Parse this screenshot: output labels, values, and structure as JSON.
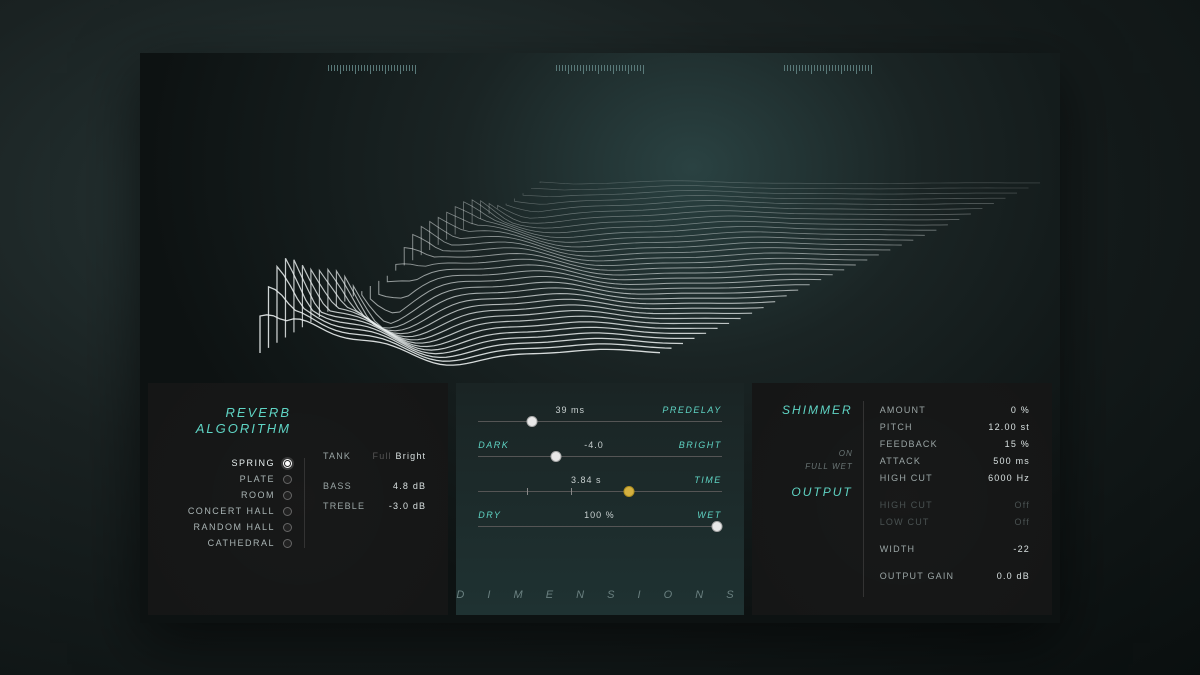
{
  "reverb_algorithm": {
    "title_line1": "REVERB",
    "title_line2": "ALGORITHM",
    "items": [
      {
        "label": "SPRING",
        "selected": true
      },
      {
        "label": "PLATE",
        "selected": false
      },
      {
        "label": "ROOM",
        "selected": false
      },
      {
        "label": "CONCERT HALL",
        "selected": false
      },
      {
        "label": "RANDOM HALL",
        "selected": false
      },
      {
        "label": "CATHEDRAL",
        "selected": false
      }
    ],
    "params": {
      "tank_label": "TANK",
      "tank_option_full": "Full",
      "tank_option_bright": "Bright",
      "tank_active": "Bright",
      "bass_label": "BASS",
      "bass_value": "4.8 dB",
      "treble_label": "TREBLE",
      "treble_value": "-3.0 dB"
    }
  },
  "dimensions": {
    "brand": "D I M E N S I O N S",
    "predelay": {
      "label": "PREDELAY",
      "value": "39 ms",
      "position": 0.22
    },
    "tone": {
      "left": "DARK",
      "right": "BRIGHT",
      "value": "-4.0",
      "position": 0.32
    },
    "time": {
      "label": "TIME",
      "value": "3.84 s",
      "position": 0.62
    },
    "mix": {
      "left": "DRY",
      "right": "WET",
      "value": "100 %",
      "position": 0.98
    }
  },
  "shimmer": {
    "title": "SHIMMER",
    "status_on": "ON",
    "status_full_wet": "FULL WET",
    "params": [
      {
        "name": "AMOUNT",
        "value": "0 %"
      },
      {
        "name": "PITCH",
        "value": "12.00 st"
      },
      {
        "name": "FEEDBACK",
        "value": "15 %"
      },
      {
        "name": "ATTACK",
        "value": "500 ms"
      },
      {
        "name": "HIGH CUT",
        "value": "6000 Hz"
      }
    ]
  },
  "output": {
    "title": "OUTPUT",
    "params": [
      {
        "name": "HIGH CUT",
        "value": "Off",
        "dim": true
      },
      {
        "name": "LOW CUT",
        "value": "Off",
        "dim": true
      },
      {
        "name": "WIDTH",
        "value": "-22",
        "dim": false
      },
      {
        "name": "OUTPUT GAIN",
        "value": "0.0 dB",
        "dim": false
      }
    ]
  }
}
